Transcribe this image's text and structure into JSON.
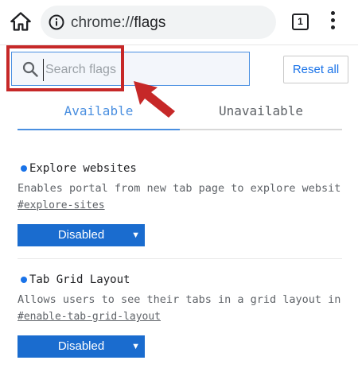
{
  "browser": {
    "url_scheme": "chrome://",
    "url_host": "flags",
    "tab_count": "1"
  },
  "search": {
    "placeholder": "Search flags",
    "value": ""
  },
  "reset_label": "Reset all",
  "tabs": [
    {
      "label": "Available",
      "active": true
    },
    {
      "label": "Unavailable",
      "active": false
    }
  ],
  "flags": [
    {
      "title": "Explore websites",
      "description": "Enables portal from new tab page to explore websites. –…",
      "link": "#explore-sites",
      "state": "Disabled"
    },
    {
      "title": "Tab Grid Layout",
      "description": "Allows users to see their tabs in a grid layout in the …",
      "link": "#enable-tab-grid-layout",
      "state": "Disabled"
    }
  ],
  "colors": {
    "accent": "#1a73e8",
    "annotation_red": "#c62828",
    "select_bg": "#1a6ccf"
  }
}
